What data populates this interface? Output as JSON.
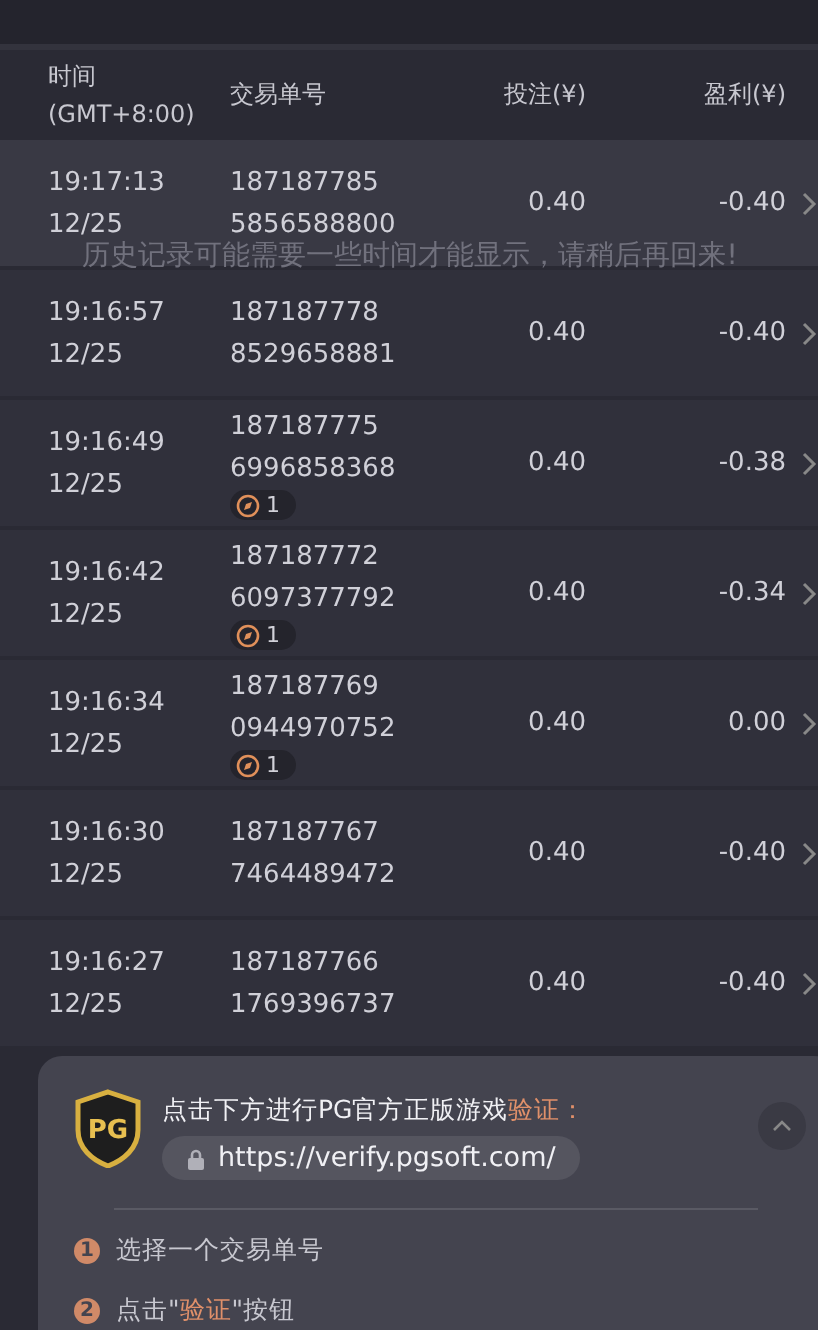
{
  "table": {
    "columns": [
      "时间\n(GMT+8:00)",
      "交易单号",
      "投注(¥)",
      "盈利(¥)"
    ],
    "rows": [
      {
        "time": "19:17:13",
        "date": "12/25",
        "txn": [
          "187187785",
          "5856588800"
        ],
        "bet": "0.40",
        "profit": "-0.40"
      },
      {
        "time": "19:16:57",
        "date": "12/25",
        "txn": [
          "187187778",
          "8529658881"
        ],
        "bet": "0.40",
        "profit": "-0.40"
      },
      {
        "time": "19:16:49",
        "date": "12/25",
        "txn": [
          "187187775",
          "6996858368"
        ],
        "badge": "1",
        "bet": "0.40",
        "profit": "-0.38"
      },
      {
        "time": "19:16:42",
        "date": "12/25",
        "txn": [
          "187187772",
          "6097377792"
        ],
        "badge": "1",
        "bet": "0.40",
        "profit": "-0.34"
      },
      {
        "time": "19:16:34",
        "date": "12/25",
        "txn": [
          "187187769",
          "0944970752"
        ],
        "badge": "1",
        "bet": "0.40",
        "profit": "0.00"
      },
      {
        "time": "19:16:30",
        "date": "12/25",
        "txn": [
          "187187767",
          "7464489472"
        ],
        "bet": "0.40",
        "profit": "-0.40"
      },
      {
        "time": "19:16:27",
        "date": "12/25",
        "txn": [
          "187187766",
          "1769396737"
        ],
        "bet": "0.40",
        "profit": "-0.40"
      }
    ]
  },
  "notice": "历史记录可能需要一些时间才能显示，请稍后再回来!",
  "verify_panel": {
    "title": "点击下方进行PG官方正版游戏",
    "title_highlight": "验证：",
    "url": "https://verify.pgsoft.com/",
    "logo": "PG",
    "expanded": true,
    "steps": [
      {
        "number": "1",
        "text": "选择一个交易单号"
      },
      {
        "number": "2",
        "text": "点击\"**验证**\"按钮"
      }
    ]
  }
}
